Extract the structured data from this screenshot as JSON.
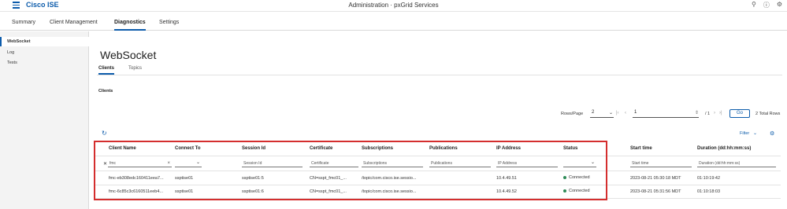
{
  "app": {
    "brand": "Cisco ISE",
    "title": "Administration · pxGrid Services",
    "icons": [
      "search-icon",
      "help-icon",
      "settings-icon"
    ]
  },
  "nav": {
    "tabs": [
      {
        "label": "Summary"
      },
      {
        "label": "Client Management"
      },
      {
        "label": "Diagnostics"
      },
      {
        "label": "Settings"
      }
    ],
    "active": "Diagnostics"
  },
  "sidebar": {
    "items": [
      {
        "label": "WebSocket"
      },
      {
        "label": "Log"
      },
      {
        "label": "Tests"
      }
    ],
    "active": "WebSocket"
  },
  "main": {
    "title": "WebSocket",
    "subtabs": [
      {
        "label": "Clients"
      },
      {
        "label": "Topics"
      }
    ],
    "section_title": "Clients"
  },
  "pagination": {
    "rows_label": "Rows/Page",
    "rows_value": "2",
    "page_value": "1",
    "page_of": "/ 1",
    "go_label": "Go",
    "total": "2 Total Rows"
  },
  "toolbar": {
    "filter_label": "Filter"
  },
  "table": {
    "columns": [
      "Client Name",
      "Connect To",
      "Session Id",
      "Certificate",
      "Subscriptions",
      "Publications",
      "IP Address",
      "Status",
      "Start time",
      "Duration (dd:hh:mm:ss)"
    ],
    "filters": {
      "client_name": "fmc",
      "session_id": "Session Id",
      "certificate": "Certificate",
      "subscriptions": "Subscriptions",
      "publications": "Publications",
      "ip_address": "IP Address",
      "start_time": "Start time",
      "duration": "Duration (dd:hh:mm:ss)"
    },
    "rows": [
      {
        "client_name": "fmc-eb308edc160411eea7...",
        "connect_to": "ssptise01",
        "session_id": "ssptise01:5",
        "certificate": "CN=sspt_fmc01_...",
        "subscriptions": "/topic/com.cisco.ise.sessio...",
        "publications": "",
        "ip_address": "10.4.49.51",
        "status": "Connected",
        "start_time": "2023-08-21 05:30:18 MDT",
        "duration": "01:10:19:42"
      },
      {
        "client_name": "fmc-6c85c3c6160511eeb4...",
        "connect_to": "ssptise01",
        "session_id": "ssptise01:6",
        "certificate": "CN=sspt_fmc01_...",
        "subscriptions": "/topic/com.cisco.ise.sessio...",
        "publications": "",
        "ip_address": "10.4.49.52",
        "status": "Connected",
        "start_time": "2023-08-21 05:31:56 MDT",
        "duration": "01:10:18:03"
      }
    ]
  },
  "colors": {
    "accent": "#0d5cab",
    "highlight": "#d42e2e",
    "status_connected": "#2e8b57"
  }
}
